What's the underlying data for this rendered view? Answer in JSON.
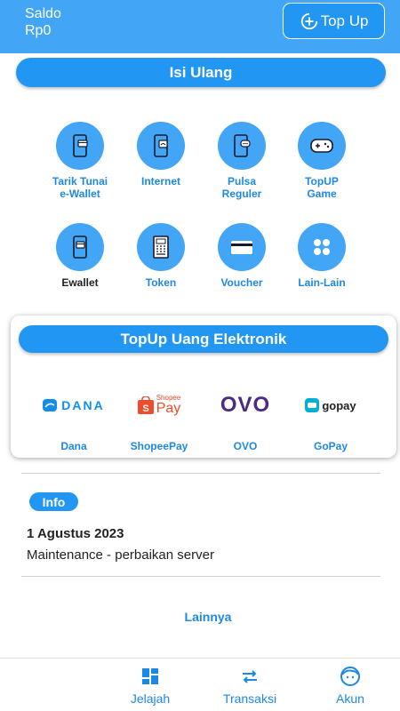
{
  "header": {
    "saldo_label": "Saldo",
    "saldo_value": "Rp0",
    "topup_label": "Top Up"
  },
  "isi_ulang": {
    "title": "Isi Ulang",
    "items": [
      {
        "label": "Tarik Tunai\ne-Wallet",
        "icon": "phone-card-icon"
      },
      {
        "label": "Internet",
        "icon": "phone-wifi-icon"
      },
      {
        "label": "Pulsa\nReguler",
        "icon": "phone-chat-icon"
      },
      {
        "label": "TopUP\nGame",
        "icon": "gamepad-icon"
      },
      {
        "label": "Ewallet",
        "icon": "phone-wallet-icon"
      },
      {
        "label": "Token",
        "icon": "meter-icon"
      },
      {
        "label": "Voucher",
        "icon": "card-icon"
      },
      {
        "label": "Lain-Lain",
        "icon": "dots-grid-icon"
      }
    ]
  },
  "uang_elektronik": {
    "title": "TopUp Uang Elektronik",
    "wallets": [
      {
        "label": "Dana",
        "logo": "DANA"
      },
      {
        "label": "ShopeePay",
        "logo_top": "Shopee",
        "logo_bottom": "Pay"
      },
      {
        "label": "OVO",
        "logo": "OVO"
      },
      {
        "label": "GoPay",
        "logo": "gopay"
      }
    ]
  },
  "info": {
    "badge": "Info",
    "date": "1 Agustus 2023",
    "text": "Maintenance - perbaikan server",
    "more": "Lainnya"
  },
  "nav": {
    "items": [
      {
        "label": "Jelajah"
      },
      {
        "label": "Transaksi"
      },
      {
        "label": "Akun"
      }
    ]
  },
  "colors": {
    "primary": "#2196f3",
    "header": "#42a5f5",
    "text_accent": "#1e88e5"
  }
}
